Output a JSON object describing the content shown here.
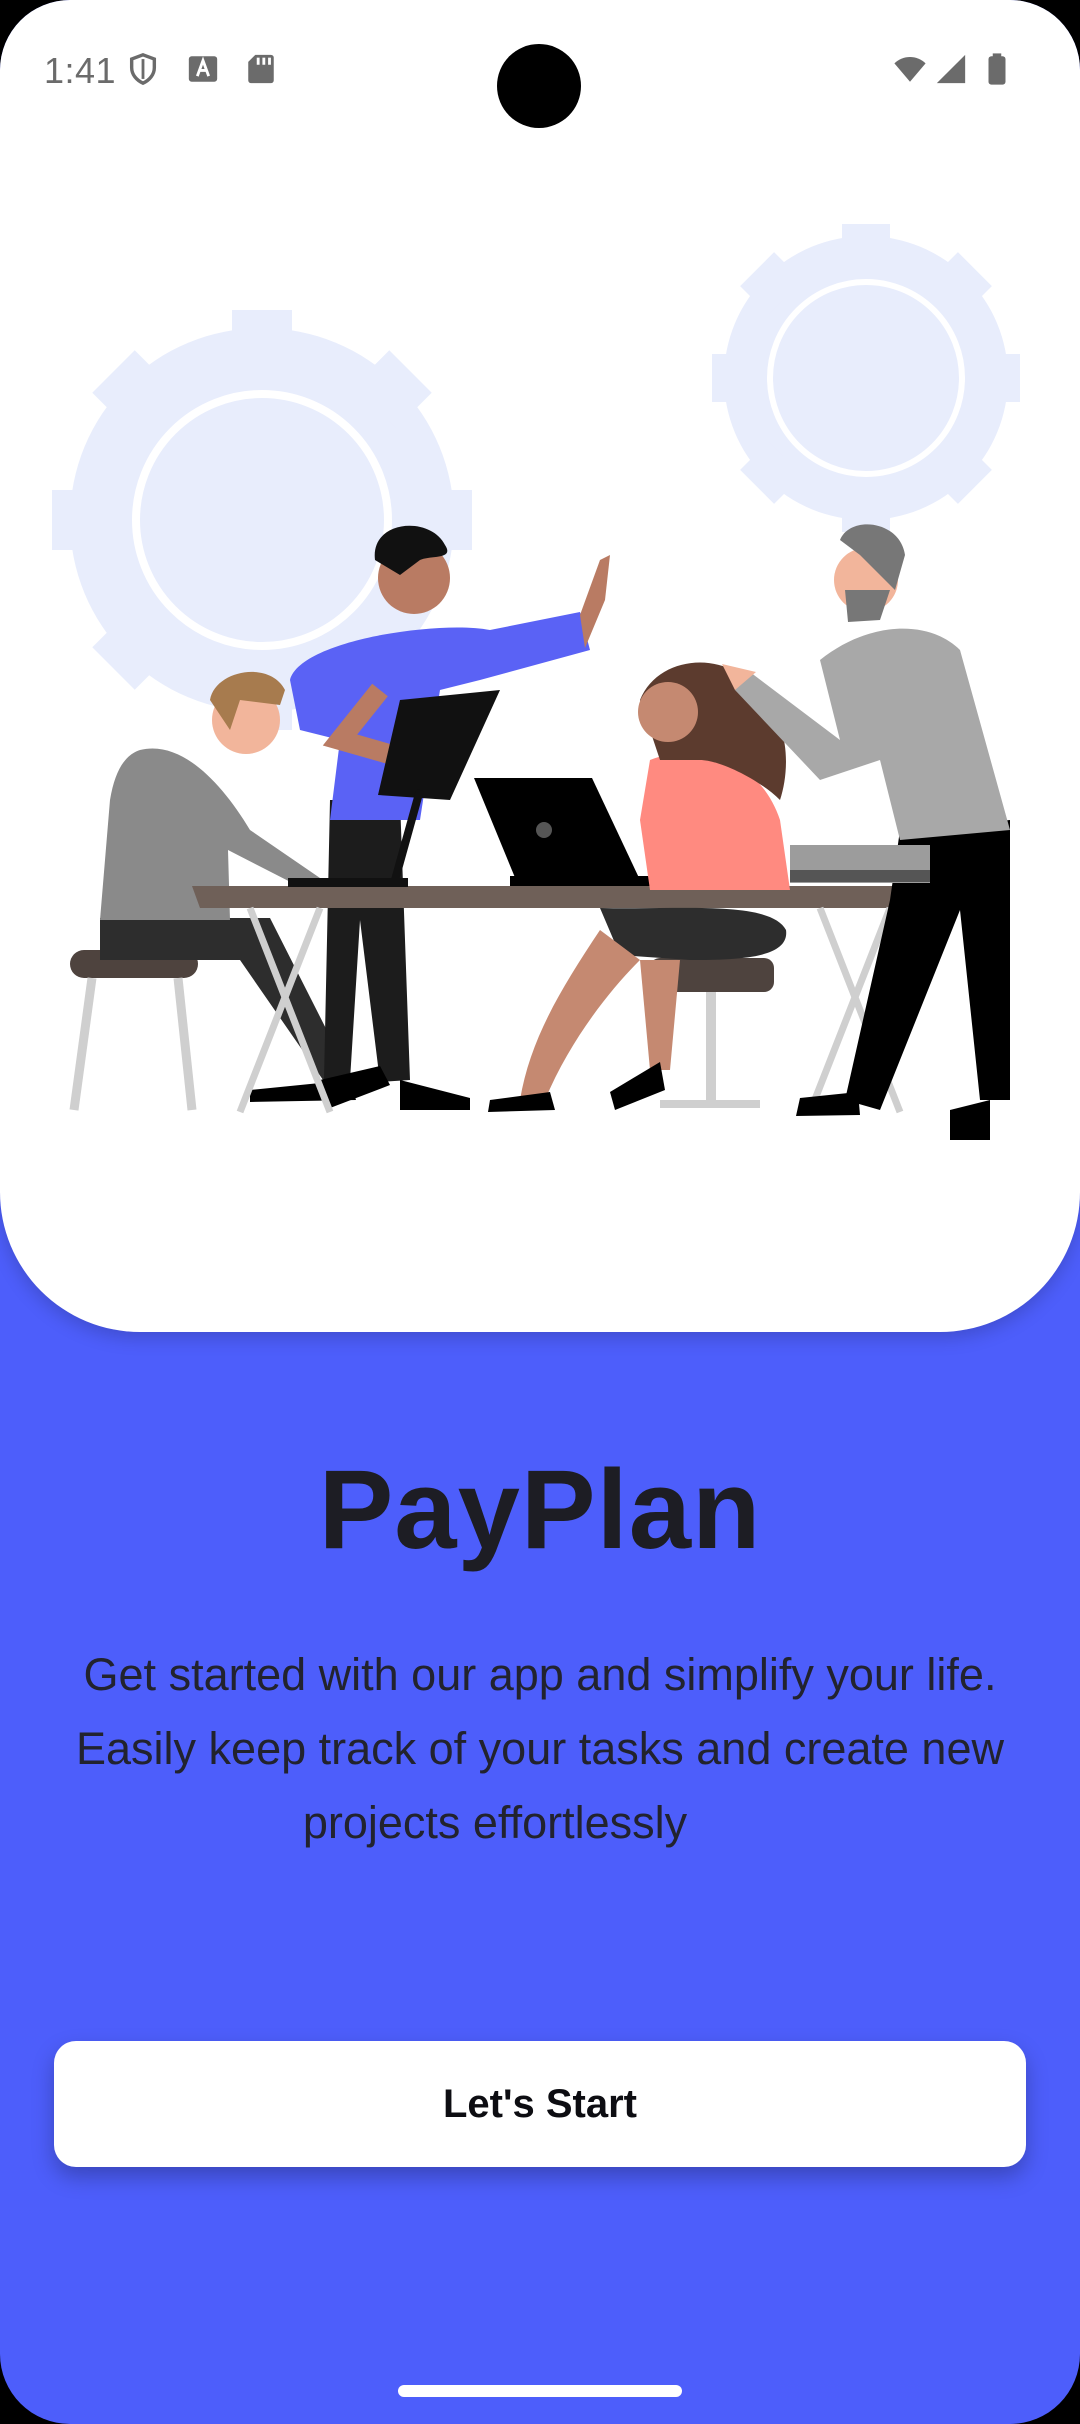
{
  "status_bar": {
    "time": "1:41",
    "icons": [
      "shield-icon",
      "keyboard-a-icon",
      "sd-card-icon",
      "wifi-icon",
      "cellular-signal-icon",
      "battery-icon"
    ]
  },
  "onboarding": {
    "title": "PayPlan",
    "description_lines": [
      "Get started with our app and simplify your life.",
      "Easily keep track of your tasks and create new",
      "projects effortlessly"
    ],
    "primary_button_label": "Let's Start"
  },
  "colors": {
    "background_accent": "#4d5efb",
    "card_background": "#ffffff",
    "gear_tint": "#e8edfc"
  }
}
